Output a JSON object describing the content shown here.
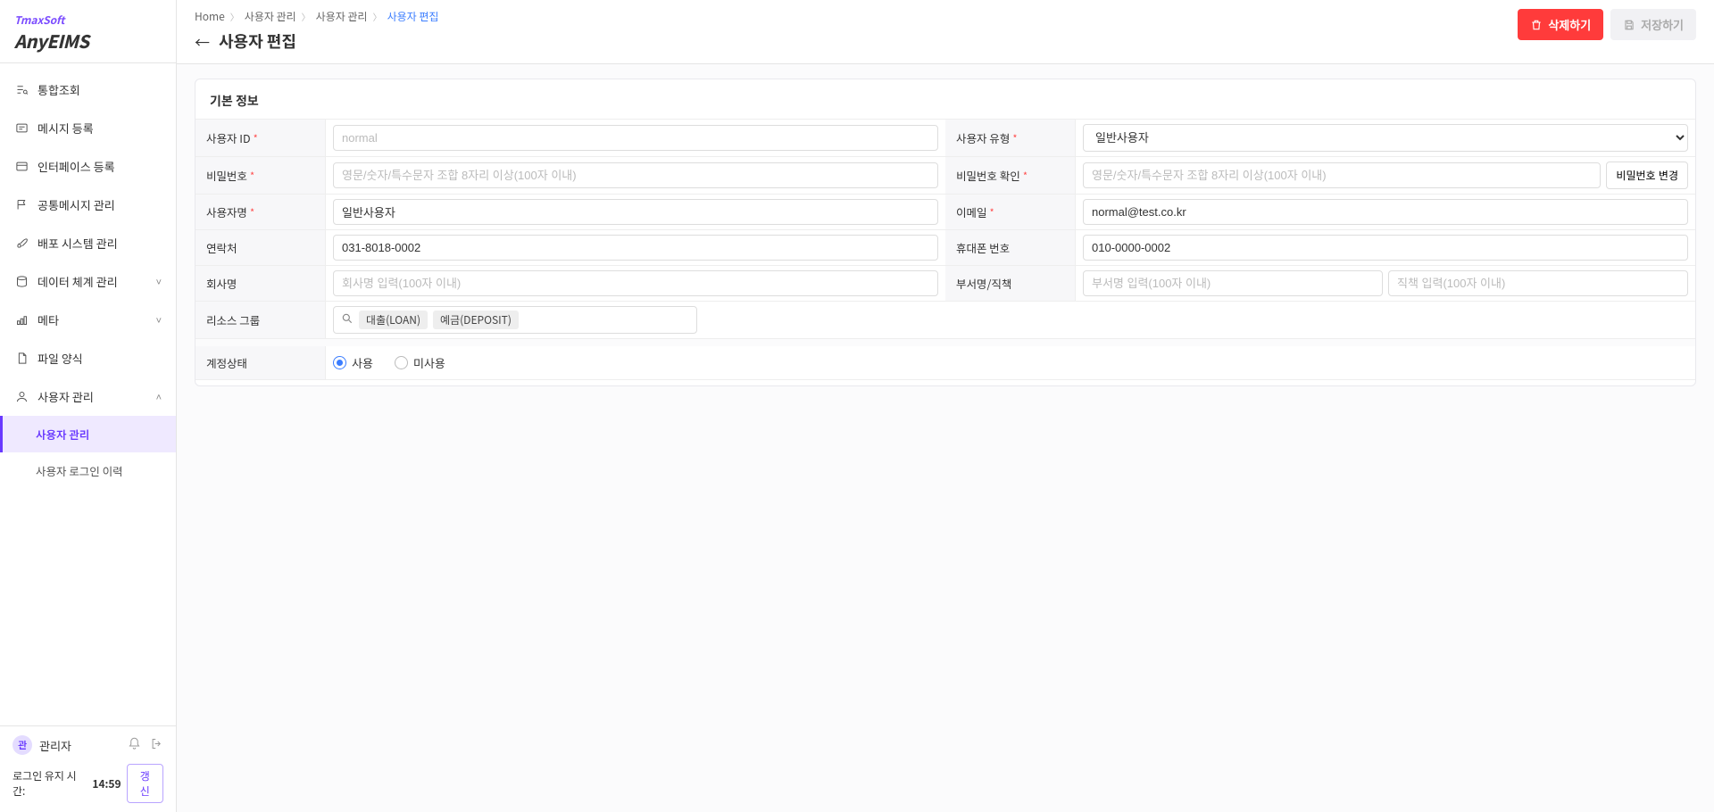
{
  "brand": {
    "top": "TmaxSoft",
    "bottom": "AnyEIMS"
  },
  "sidebar": {
    "items": [
      {
        "label": "통합조회",
        "icon": "search"
      },
      {
        "label": "메시지 등록",
        "icon": "message"
      },
      {
        "label": "인터페이스 등록",
        "icon": "interface"
      },
      {
        "label": "공통메시지 관리",
        "icon": "flag"
      },
      {
        "label": "배포 시스템 관리",
        "icon": "deploy"
      },
      {
        "label": "데이터 체계 관리",
        "icon": "data",
        "expandable": true,
        "chev": "˅"
      },
      {
        "label": "메타",
        "icon": "meta",
        "expandable": true,
        "chev": "˅"
      },
      {
        "label": "파일 양식",
        "icon": "file"
      },
      {
        "label": "사용자 관리",
        "icon": "user",
        "expandable": true,
        "chev": "˄",
        "open": true
      }
    ],
    "subitems": [
      {
        "label": "사용자 관리",
        "active": true
      },
      {
        "label": "사용자 로그인 이력",
        "active": false
      }
    ]
  },
  "footer": {
    "avatarInitial": "관",
    "userName": "관리자",
    "loginLabel": "로그인 유지 시간:",
    "loginTime": "14:59",
    "refresh": "갱신"
  },
  "breadcrumb": {
    "items": [
      "Home",
      "사용자 관리",
      "사용자 관리"
    ],
    "current": "사용자 편집"
  },
  "page": {
    "title": "사용자 편집",
    "deleteBtn": "삭제하기",
    "saveBtn": "저장하기"
  },
  "panel": {
    "title": "기본 정보"
  },
  "labels": {
    "userId": "사용자 ID",
    "userType": "사용자 유형",
    "password": "비밀번호",
    "passwordConfirm": "비밀번호 확인",
    "changePassword": "비밀번호 변경",
    "userName": "사용자명",
    "email": "이메일",
    "contact": "연락처",
    "mobile": "휴대폰 번호",
    "company": "회사명",
    "deptTitle": "부서명/직책",
    "resourceGroup": "리소스 그룹",
    "accountStatus": "계정상태"
  },
  "placeholders": {
    "userId": "normal",
    "password": "영문/숫자/특수문자 조합 8자리 이상(100자 이내)",
    "passwordConfirm": "영문/숫자/특수문자 조합 8자리 이상(100자 이내)",
    "company": "회사명 입력(100자 이내)",
    "dept": "부서명 입력(100자 이내)",
    "title": "직책 입력(100자 이내)"
  },
  "values": {
    "userType": "일반사용자",
    "userName": "일반사용자",
    "email": "normal@test.co.kr",
    "contact": "031-8018-0002",
    "mobile": "010-0000-0002"
  },
  "resourceTags": [
    "대출(LOAN)",
    "예금(DEPOSIT)"
  ],
  "accountStatus": {
    "options": [
      "사용",
      "미사용"
    ],
    "selected": "사용"
  }
}
